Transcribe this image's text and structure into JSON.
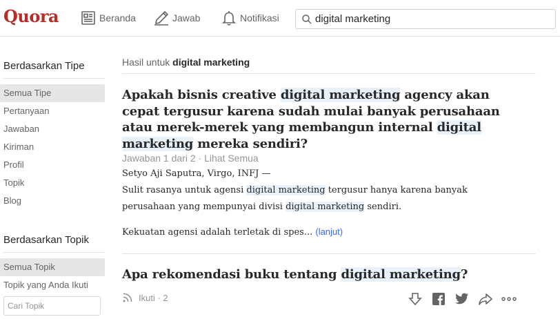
{
  "header": {
    "logo": "Quora",
    "nav": [
      {
        "label": "Beranda",
        "icon": "home-feed-icon"
      },
      {
        "label": "Jawab",
        "icon": "pencil-icon"
      },
      {
        "label": "Notifikasi",
        "icon": "bell-icon"
      }
    ],
    "search": {
      "value": "digital marketing",
      "icon": "search-icon"
    }
  },
  "sidebar": {
    "type_heading": "Berdasarkan Tipe",
    "type_items": [
      "Semua Tipe",
      "Pertanyaan",
      "Jawaban",
      "Kiriman",
      "Profil",
      "Topik",
      "Blog"
    ],
    "topic_heading": "Berdasarkan Topik",
    "topic_items": [
      "Semua Topik",
      "Topik yang Anda Ikuti"
    ],
    "topic_search_placeholder": "Cari Topik"
  },
  "main": {
    "results_prefix": "Hasil untuk",
    "results_query": "digital marketing",
    "result1": {
      "title_parts": [
        "Apakah bisnis creative ",
        "digital marketing",
        " agency akan cepat tergusur karena sudah mulai banyak perusahaan atau merek-merek yang membangun internal ",
        "digital marketing",
        " mereka sendiri?"
      ],
      "meta": "Jawaban 1 dari 2 · Lihat Semua",
      "author": "Setyo Aji Saputra, Virgo, INFJ —",
      "answer_parts": [
        "Sulit rasanya untuk agensi ",
        "digital marketing",
        " tergusur hanya karena banyak perusahaan yang mempunyai divisi ",
        "digital marketing",
        " sendiri."
      ],
      "answer_second": "Kekuatan agensi adalah terletak di spes...",
      "more_label": "(lanjut)"
    },
    "result2": {
      "title_parts": [
        "Apa rekomendasi buku tentang ",
        "digital marketing",
        "?"
      ],
      "follow_label": "Ikuti",
      "follow_count": "· 2",
      "actions": [
        "downvote-icon",
        "facebook-icon",
        "twitter-icon",
        "share-icon",
        "more-options-icon"
      ]
    }
  },
  "colors": {
    "brand": "#b92b27",
    "highlight": "#e9f1fb",
    "link": "#2e69ff",
    "active_sidebar": "#e6e6e6"
  }
}
